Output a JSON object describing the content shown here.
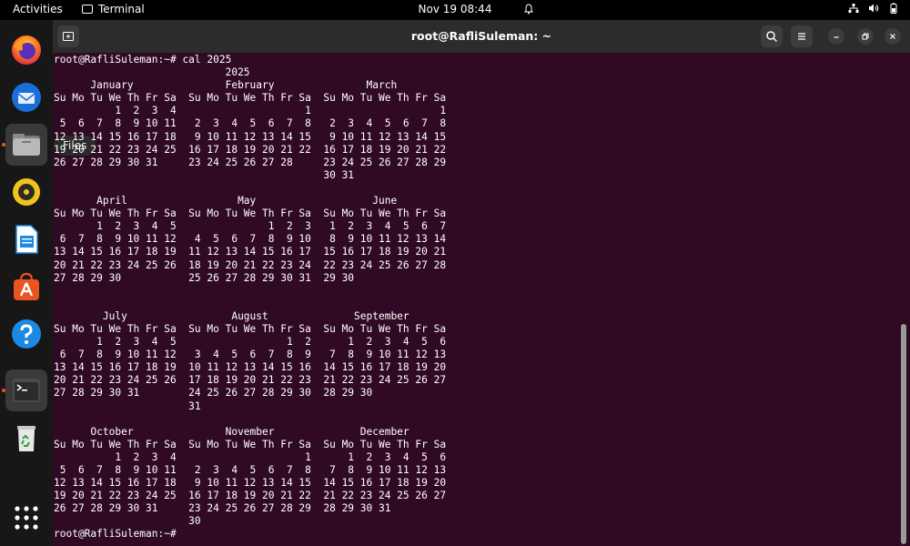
{
  "topbar": {
    "activities": "Activities",
    "app_name": "Terminal",
    "clock": "Nov 19  08:44"
  },
  "dock": {
    "items": [
      {
        "name": "Firefox",
        "icon": "firefox-icon"
      },
      {
        "name": "Thunderbird",
        "icon": "thunderbird-icon"
      },
      {
        "name": "Files",
        "icon": "files-icon"
      },
      {
        "name": "Rhythmbox",
        "icon": "rhythmbox-icon"
      },
      {
        "name": "LibreOffice Writer",
        "icon": "writer-icon"
      },
      {
        "name": "Ubuntu Software",
        "icon": "software-icon"
      },
      {
        "name": "Help",
        "icon": "help-icon"
      },
      {
        "name": "Terminal",
        "icon": "terminal-icon"
      },
      {
        "name": "Trash",
        "icon": "trash-icon"
      },
      {
        "name": "Show Applications",
        "icon": "app-grid-icon"
      }
    ],
    "tooltip": "Files"
  },
  "window": {
    "title": "root@RafliSuleman: ~"
  },
  "terminal": {
    "lines": [
      "root@RafliSuleman:~# cal 2025",
      "                            2025",
      "      January               February               March",
      "Su Mo Tu We Th Fr Sa  Su Mo Tu We Th Fr Sa  Su Mo Tu We Th Fr Sa",
      "          1  2  3  4                     1                     1",
      " 5  6  7  8  9 10 11   2  3  4  5  6  7  8   2  3  4  5  6  7  8",
      "12 13 14 15 16 17 18   9 10 11 12 13 14 15   9 10 11 12 13 14 15",
      "19 20 21 22 23 24 25  16 17 18 19 20 21 22  16 17 18 19 20 21 22",
      "26 27 28 29 30 31     23 24 25 26 27 28     23 24 25 26 27 28 29",
      "                                            30 31",
      "",
      "       April                  May                   June",
      "Su Mo Tu We Th Fr Sa  Su Mo Tu We Th Fr Sa  Su Mo Tu We Th Fr Sa",
      "       1  2  3  4  5               1  2  3   1  2  3  4  5  6  7",
      " 6  7  8  9 10 11 12   4  5  6  7  8  9 10   8  9 10 11 12 13 14",
      "13 14 15 16 17 18 19  11 12 13 14 15 16 17  15 16 17 18 19 20 21",
      "20 21 22 23 24 25 26  18 19 20 21 22 23 24  22 23 24 25 26 27 28",
      "27 28 29 30           25 26 27 28 29 30 31  29 30",
      "",
      "",
      "        July                 August              September",
      "Su Mo Tu We Th Fr Sa  Su Mo Tu We Th Fr Sa  Su Mo Tu We Th Fr Sa",
      "       1  2  3  4  5                  1  2      1  2  3  4  5  6",
      " 6  7  8  9 10 11 12   3  4  5  6  7  8  9   7  8  9 10 11 12 13",
      "13 14 15 16 17 18 19  10 11 12 13 14 15 16  14 15 16 17 18 19 20",
      "20 21 22 23 24 25 26  17 18 19 20 21 22 23  21 22 23 24 25 26 27",
      "27 28 29 30 31        24 25 26 27 28 29 30  28 29 30",
      "                      31",
      "",
      "      October               November              December",
      "Su Mo Tu We Th Fr Sa  Su Mo Tu We Th Fr Sa  Su Mo Tu We Th Fr Sa",
      "          1  2  3  4                     1      1  2  3  4  5  6",
      " 5  6  7  8  9 10 11   2  3  4  5  6  7  8   7  8  9 10 11 12 13",
      "12 13 14 15 16 17 18   9 10 11 12 13 14 15  14 15 16 17 18 19 20",
      "19 20 21 22 23 24 25  16 17 18 19 20 21 22  21 22 23 24 25 26 27",
      "26 27 28 29 30 31     23 24 25 26 27 28 29  28 29 30 31",
      "                      30",
      "root@RafliSuleman:~# "
    ]
  },
  "colors": {
    "terminal_bg": "#300a24",
    "accent": "#e95420"
  }
}
